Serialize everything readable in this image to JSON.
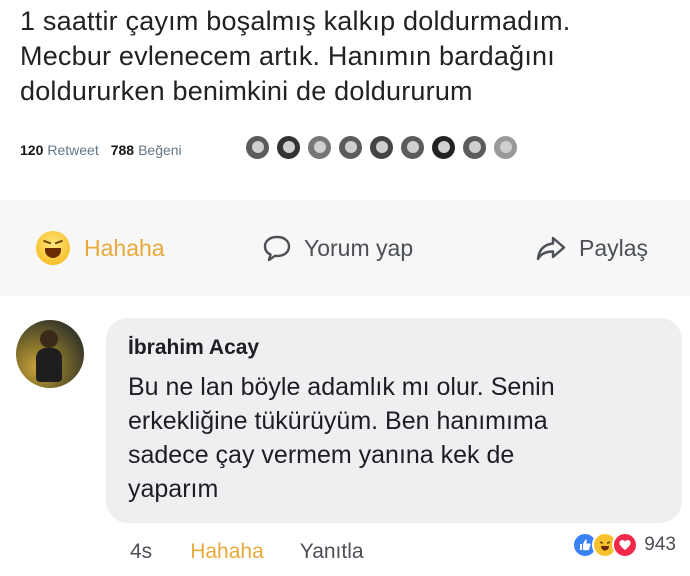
{
  "tweet": {
    "text_lines": [
      "1 saattir çayım boşalmış kalkıp doldurmadım.",
      "Mecbur evlenecem artık. Hanımın bardağını",
      "doldururken benimkini de doldururum"
    ],
    "retweet_count": "120",
    "retweet_label": "Retweet",
    "like_count": "788",
    "like_label": "Beğeni",
    "liker_faces": 10
  },
  "actions": {
    "haha_label": "Hahaha",
    "comment_label": "Yorum yap",
    "share_label": "Paylaş",
    "haha_icon": "haha-emoji-icon",
    "comment_icon": "comment-bubble-icon",
    "share_icon": "share-arrow-icon",
    "haha_color": "#e8a93a"
  },
  "comment": {
    "author": "İbrahim Acay",
    "text_lines": [
      "Bu ne lan böyle adamlık mı olur. Senin",
      "erkekliğine tükürüyüm. Ben hanımıma",
      "sadece çay vermem yanına kek de",
      "yaparım"
    ],
    "time": "4s",
    "reaction_label": "Hahaha",
    "reply_label": "Yanıtla",
    "reaction_count": "943",
    "reaction_icons": [
      "like-icon",
      "haha-icon",
      "love-icon"
    ]
  }
}
